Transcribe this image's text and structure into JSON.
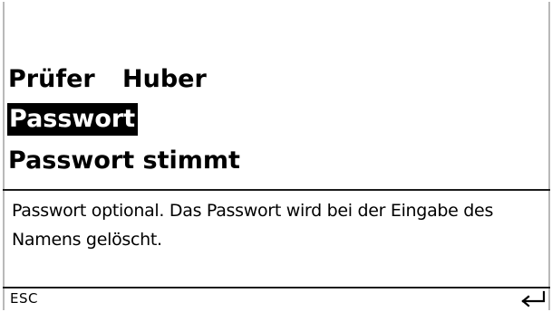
{
  "parameters": {
    "tester_label": "Prüfer",
    "tester_value": "Huber",
    "password_label": "Passwort",
    "password_status": "Passwort stimmt"
  },
  "help": {
    "text": "Passwort optional. Das Passwort wird bei der Eingabe des Namens gelöscht."
  },
  "footer": {
    "esc_label": "ESC",
    "enter_icon": "enter-return-icon"
  }
}
